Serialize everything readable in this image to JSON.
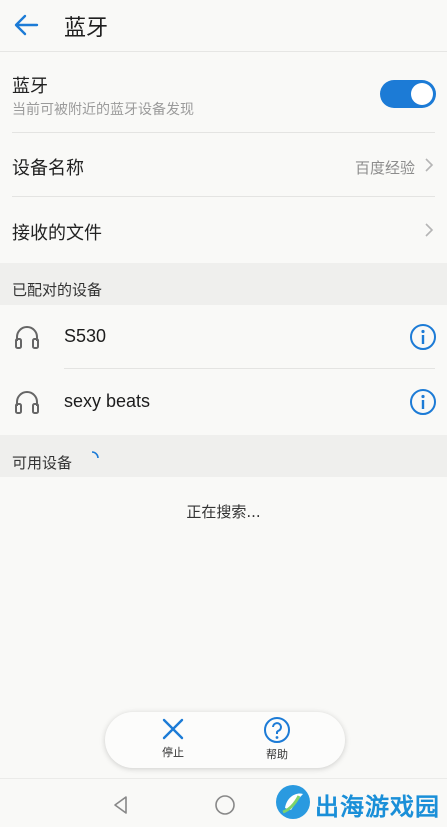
{
  "header": {
    "title": "蓝牙",
    "back_icon": "arrow-left-icon"
  },
  "bluetooth": {
    "title": "蓝牙",
    "subtitle": "当前可被附近的蓝牙设备发现",
    "enabled": true,
    "accent_color": "#1c7bd6"
  },
  "device_name": {
    "label": "设备名称",
    "value": "百度经验"
  },
  "received_files": {
    "label": "接收的文件"
  },
  "paired": {
    "section_label": "已配对的设备",
    "devices": [
      {
        "name": "S530",
        "icon": "headphones-icon",
        "action_icon": "info-icon"
      },
      {
        "name": "sexy beats",
        "icon": "headphones-icon",
        "action_icon": "info-icon"
      }
    ]
  },
  "available": {
    "section_label": "可用设备",
    "status": "正在搜索..."
  },
  "actions": {
    "stop_label": "停止",
    "help_label": "帮助"
  },
  "navbar": {
    "icons": [
      "back-triangle-icon",
      "home-circle-icon"
    ]
  },
  "watermark": {
    "text": "出海游戏园"
  }
}
